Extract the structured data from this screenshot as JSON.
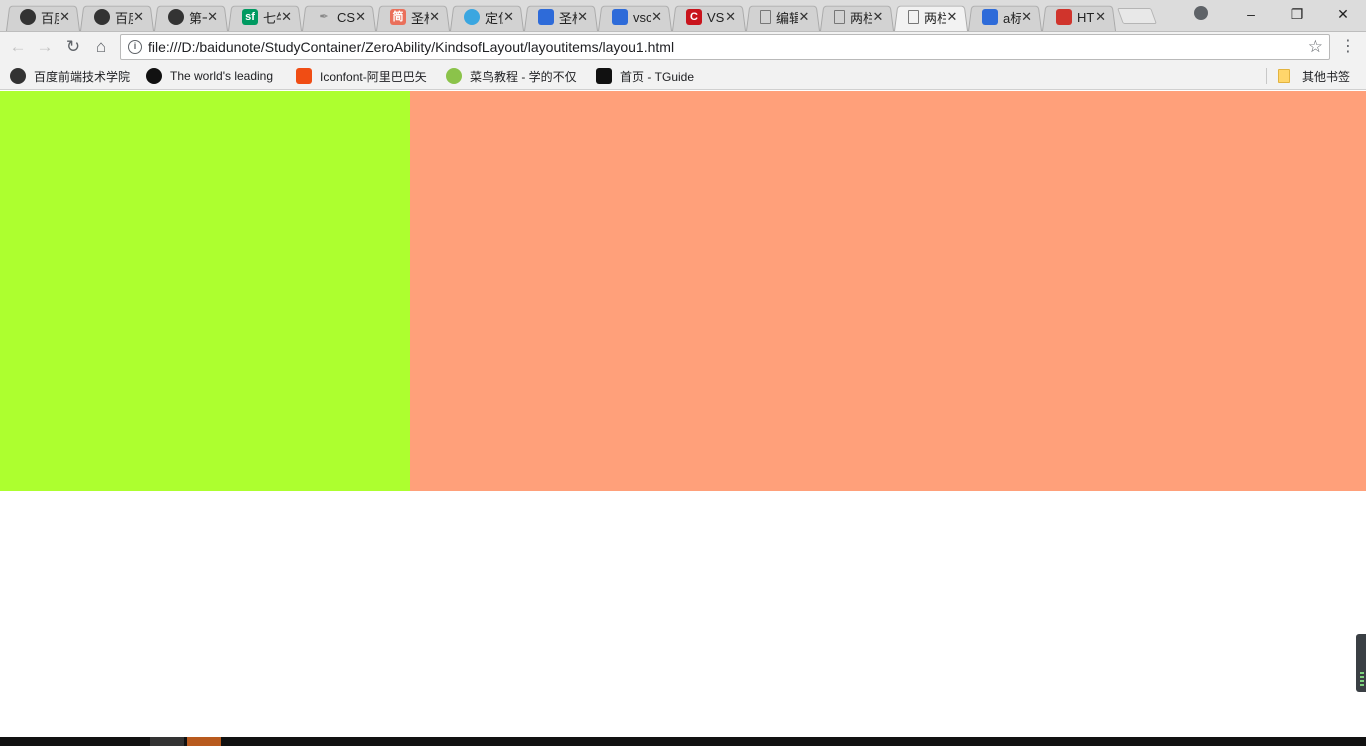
{
  "browser": {
    "tabs": [
      {
        "title": "百度",
        "icon": "dark-globe-icon",
        "color": "#333333"
      },
      {
        "title": "百度",
        "icon": "dark-globe-icon",
        "color": "#333333"
      },
      {
        "title": "第一",
        "icon": "dark-globe-icon",
        "color": "#333333"
      },
      {
        "title": "七牛",
        "icon": "sf-icon",
        "glyph": "sf",
        "color": "#009a61"
      },
      {
        "title": "CS",
        "icon": "quill-icon",
        "color": "#888888"
      },
      {
        "title": "圣杯",
        "icon": "jianshu-icon",
        "glyph": "简",
        "color": "#ea6f5a"
      },
      {
        "title": "定位",
        "icon": "bird-icon",
        "color": "#3aa6e0"
      },
      {
        "title": "圣杯",
        "icon": "baidu-paw-icon",
        "color": "#2e6bd9"
      },
      {
        "title": "vsc",
        "icon": "baidu-paw-icon",
        "color": "#2e6bd9"
      },
      {
        "title": "VS",
        "icon": "csdn-icon",
        "glyph": "C",
        "color": "#c9141c"
      },
      {
        "title": "编辑",
        "icon": "page-icon",
        "color": "#777777"
      },
      {
        "title": "两栏",
        "icon": "page-icon",
        "color": "#777777"
      },
      {
        "title": "两栏",
        "icon": "page-icon",
        "color": "#777777",
        "active": true
      },
      {
        "title": "a标",
        "icon": "baidu-paw-icon",
        "color": "#2e6bd9"
      },
      {
        "title": "HT",
        "icon": "html5-icon",
        "color": "#d0342c"
      }
    ],
    "address": {
      "url": "file:///D:/baidunote/StudyContainer/ZeroAbility/KindsofLayout/layoutitems/layou1.html"
    },
    "bookmarks": [
      {
        "label": "百度前端技术学院",
        "icon": "dark-globe-icon",
        "color": "#333333"
      },
      {
        "label": "The world's leading",
        "icon": "github-icon",
        "color": "#111111"
      },
      {
        "label": "Iconfont-阿里巴巴矢",
        "icon": "iconfont-icon",
        "color": "#f04d14"
      },
      {
        "label": "菜鸟教程 - 学的不仅",
        "icon": "runoob-icon",
        "color": "#8bc34a"
      },
      {
        "label": "首页 - TGuide",
        "icon": "tguide-icon",
        "color": "#111111"
      }
    ],
    "other_bookmarks": "其他书签"
  },
  "page": {
    "left_color": "#adff2f",
    "right_color": "#ffa07a"
  }
}
